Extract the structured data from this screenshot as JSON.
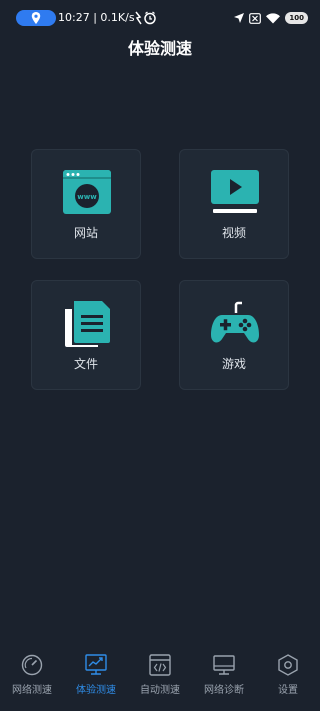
{
  "status_bar": {
    "time_speed": "10:27 | 0.1K/s",
    "battery": "100",
    "icons": [
      "location-pin-icon",
      "bolt-icon",
      "alarm-icon",
      "navigation-arrow-icon",
      "sim-x-icon",
      "wifi-icon",
      "battery-icon"
    ]
  },
  "header": {
    "title": "体验测速"
  },
  "cards": {
    "website": {
      "label": "网站",
      "icon": "www-browser-icon"
    },
    "video": {
      "label": "视频",
      "icon": "video-play-icon"
    },
    "file": {
      "label": "文件",
      "icon": "document-icon"
    },
    "game": {
      "label": "游戏",
      "icon": "gamepad-icon"
    }
  },
  "bottom_nav": {
    "items": [
      {
        "label": "网络测速",
        "icon": "speedometer-icon",
        "active": false
      },
      {
        "label": "体验测速",
        "icon": "chart-monitor-icon",
        "active": true
      },
      {
        "label": "自动测速",
        "icon": "code-window-icon",
        "active": false
      },
      {
        "label": "网络诊断",
        "icon": "monitor-icon",
        "active": false
      },
      {
        "label": "设置",
        "icon": "hexagon-settings-icon",
        "active": false
      }
    ]
  },
  "colors": {
    "background": "#1b222d",
    "card": "#202935",
    "accent_teal": "#2bb3b1",
    "accent_blue": "#2f8de8",
    "nav_inactive": "#9aa3ae"
  }
}
